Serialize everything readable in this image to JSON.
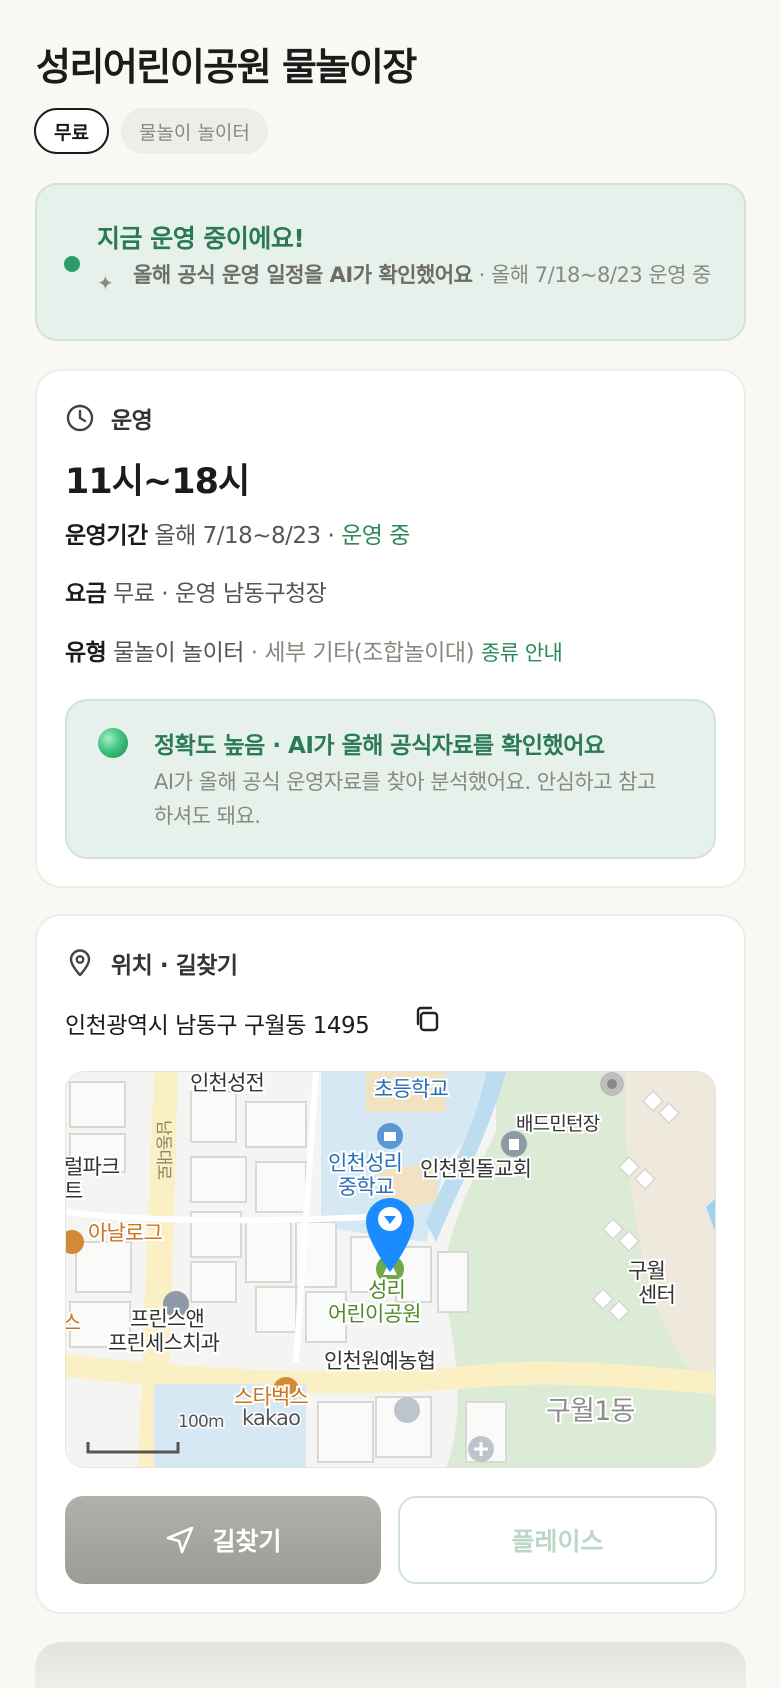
{
  "page": {
    "title": "성리어린이공원 물놀이장",
    "tags": [
      "무료",
      "물놀이 놀이터"
    ]
  },
  "status": {
    "title": "지금 운영 중이에요!",
    "sub_bold": "올해 공식 운영 일정을 AI가 확인했어요",
    "sub_rest": " · 올해 7/18~8/23 운영 중"
  },
  "operation": {
    "section_label": "운영",
    "hours": "11시~18시",
    "period_key": "운영기간",
    "period_value": " 올해 7/18~8/23 · ",
    "period_status": "운영 중",
    "fee_key": "요금",
    "fee_value": " 무료 · 운영 남동구청장",
    "type_key": "유형",
    "type_value": " 물놀이 놀이터",
    "type_detail": " · 세부 기타(조합놀이대) ",
    "type_link": "종류 안내",
    "accuracy_title": "정확도 높음 · AI가 올해 공식자료를 확인했어요",
    "accuracy_body": "AI가 올해 공식 운영자료를 찾아 분석했어요. 안심하고 참고하셔도 돼요."
  },
  "location": {
    "section_label": "위치 · 길찾기",
    "address": "인천광역시 남동구 구월동 1495",
    "map": {
      "labels": {
        "incheon_seongjeon": "인천성전",
        "elementary": "초등학교",
        "badminton": "배드민턴장",
        "park_cut": "럴파크",
        "park_cut2": "트",
        "road": "남동대로",
        "middle1": "인천성리",
        "middle2": "중학교",
        "church": "인천흰돌교회",
        "analog": "아날로그",
        "prince1": "프린스앤",
        "prince2": "프린세스치과",
        "s_cut": "스",
        "park1": "성리",
        "park2": "어린이공원",
        "nonghyup": "인천원예농협",
        "starbucks": "스타벅스",
        "guwol_cut1": "구월",
        "guwol_cut2": "센터",
        "guwol1dong": "구월1동",
        "scale": "100m",
        "brand": "kakao"
      }
    },
    "route_button": "길찾기",
    "place_button": "플레이스"
  },
  "colors": {
    "accent_green": "#2b7a55",
    "banner_bg": "#e6f1ec",
    "map_pin": "#1a8cff"
  },
  "icons": {
    "sparkle": "sparkle-icon",
    "clock": "clock-icon",
    "pin": "location-pin-icon",
    "copy": "copy-icon",
    "navigate": "navigate-arrow-icon"
  }
}
